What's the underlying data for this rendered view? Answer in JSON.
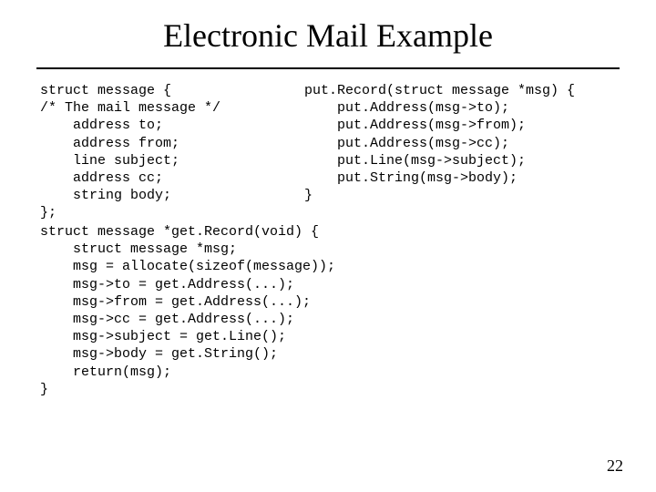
{
  "title": "Electronic Mail Example",
  "code": {
    "left": "struct message {\n/* The mail message */\n    address to;\n    address from;\n    line subject;\n    address cc;\n    string body;\n};",
    "right": "put.Record(struct message *msg) {\n    put.Address(msg->to);\n    put.Address(msg->from);\n    put.Address(msg->cc);\n    put.Line(msg->subject);\n    put.String(msg->body);\n}",
    "bottom": "struct message *get.Record(void) {\n    struct message *msg;\n    msg = allocate(sizeof(message));\n    msg->to = get.Address(...);\n    msg->from = get.Address(...);\n    msg->cc = get.Address(...);\n    msg->subject = get.Line();\n    msg->body = get.String();\n    return(msg);\n}"
  },
  "pageNumber": "22"
}
